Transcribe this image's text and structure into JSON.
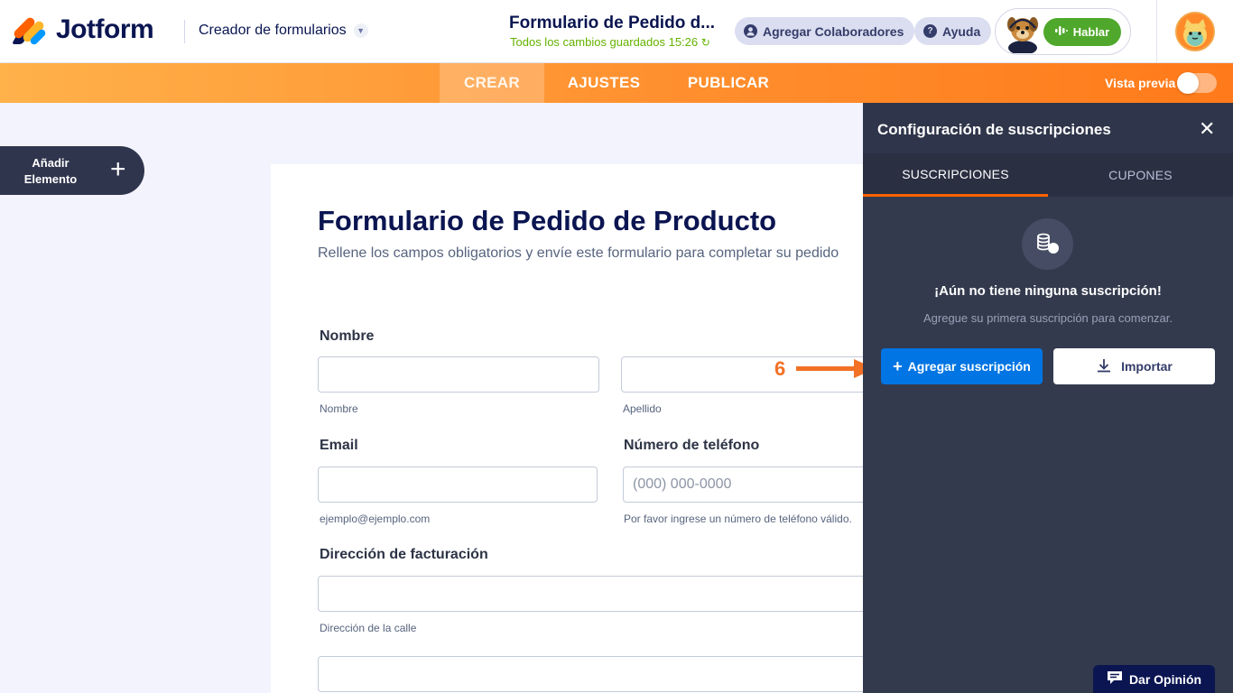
{
  "header": {
    "logo_text": "Jotform",
    "builder_label": "Creador de formularios",
    "form_title": "Formulario de Pedido d...",
    "saved_status": "Todos los cambios guardados 15:26",
    "collaborators_label": "Agregar Colaboradores",
    "help_label": "Ayuda",
    "talk_label": "Hablar"
  },
  "nav": {
    "tabs": [
      {
        "label": "CREAR",
        "active": true
      },
      {
        "label": "AJUSTES",
        "active": false
      },
      {
        "label": "PUBLICAR",
        "active": false
      }
    ],
    "preview_label": "Vista previa",
    "preview_on": false
  },
  "sidebar": {
    "add_element_label_1": "Añadir",
    "add_element_label_2": "Elemento"
  },
  "form": {
    "title": "Formulario de Pedido de Producto",
    "subtitle": "Rellene los campos obligatorios y envíe este formulario para completar su pedido",
    "name_label": "Nombre",
    "first_name_hint": "Nombre",
    "last_name_hint": "Apellido",
    "email_label": "Email",
    "email_hint": "ejemplo@ejemplo.com",
    "phone_label": "Número de teléfono",
    "phone_placeholder": "(000) 000-0000",
    "phone_hint": "Por favor ingrese un número de teléfono válido.",
    "billing_label": "Dirección de facturación",
    "street_hint": "Dirección de la calle"
  },
  "panel": {
    "title": "Configuración de suscripciones",
    "tabs": [
      {
        "label": "SUSCRIPCIONES",
        "active": true
      },
      {
        "label": "CUPONES",
        "active": false
      }
    ],
    "empty_title": "¡Aún no tiene ninguna suscripción!",
    "empty_subtitle": "Agregue su primera suscripción para comenzar.",
    "add_button": "Agregar suscripción",
    "import_button": "Importar"
  },
  "annotation": {
    "step": "6",
    "color": "#f27125"
  },
  "feedback_label": "Dar Opinión",
  "colors": {
    "brand_orange": "#ff6100",
    "primary_blue": "#0075e3",
    "navy": "#0a1551",
    "panel_bg": "#343a4e",
    "success_green": "#64b200"
  }
}
